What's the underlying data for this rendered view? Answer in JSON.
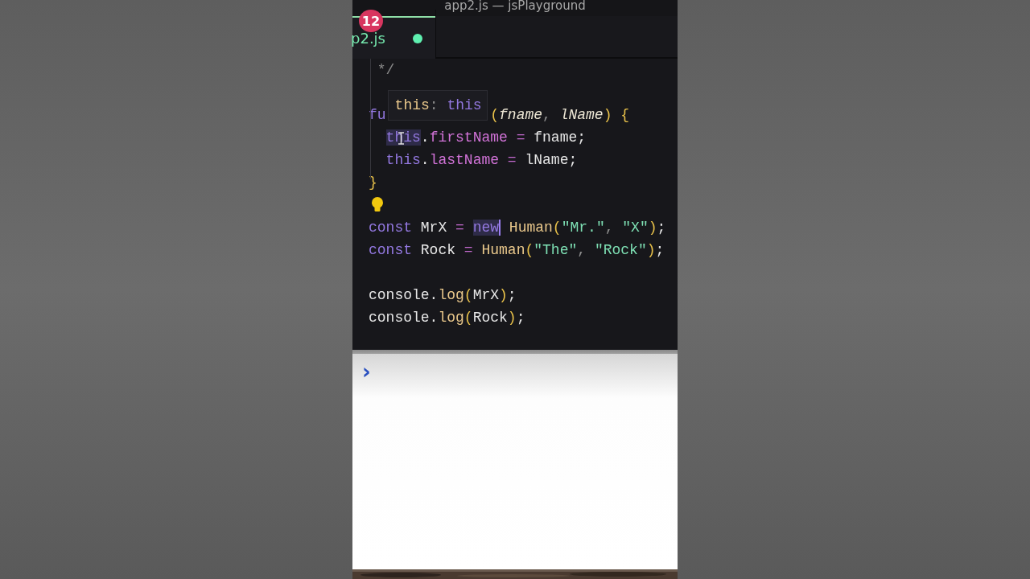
{
  "window": {
    "title": "app2.js — jsPlayground"
  },
  "tabs": [
    {
      "label": "p2.js",
      "selected": true,
      "modified": true,
      "badge": "12"
    }
  ],
  "tooltip": [
    {
      "text": "this",
      "kind": "func"
    },
    {
      "text": ": ",
      "kind": "punct"
    },
    {
      "text": "this",
      "kind": "keyword"
    }
  ],
  "code_lines": [
    {
      "kind": "code",
      "tokens": [
        {
          "text": " */",
          "kind": "comment",
          "highlighted": false,
          "caret": false
        }
      ]
    },
    {
      "kind": "blank"
    },
    {
      "kind": "covered",
      "tokens": [
        {
          "text": "fu",
          "kind": "keyword",
          "highlighted": false,
          "caret": false
        }
      ],
      "rest": [
        {
          "text": "(",
          "kind": "paren",
          "highlighted": false,
          "caret": false
        },
        {
          "text": "fname",
          "kind": "param",
          "highlighted": false,
          "caret": false
        },
        {
          "text": ", ",
          "kind": "punct",
          "highlighted": false,
          "caret": false
        },
        {
          "text": "lName",
          "kind": "param",
          "highlighted": false,
          "caret": false
        },
        {
          "text": ")",
          "kind": "paren",
          "highlighted": false,
          "caret": false
        },
        {
          "text": " {",
          "kind": "paren",
          "highlighted": false,
          "caret": false
        }
      ]
    },
    {
      "kind": "indented",
      "tokens": [
        {
          "text": "this",
          "kind": "keyword",
          "highlighted": true,
          "caret": false
        },
        {
          "text": ".",
          "kind": "plain",
          "highlighted": false,
          "caret": false
        },
        {
          "text": "firstName",
          "kind": "property",
          "highlighted": false,
          "caret": false
        },
        {
          "text": " = ",
          "kind": "operator",
          "highlighted": false,
          "caret": false
        },
        {
          "text": "fname;",
          "kind": "plain",
          "highlighted": false,
          "caret": false
        }
      ]
    },
    {
      "kind": "indented",
      "tokens": [
        {
          "text": "this",
          "kind": "keyword",
          "highlighted": false,
          "caret": false
        },
        {
          "text": ".",
          "kind": "plain",
          "highlighted": false,
          "caret": false
        },
        {
          "text": "lastName",
          "kind": "property",
          "highlighted": false,
          "caret": false
        },
        {
          "text": " = ",
          "kind": "operator",
          "highlighted": false,
          "caret": false
        },
        {
          "text": "lName;",
          "kind": "plain",
          "highlighted": false,
          "caret": false
        }
      ]
    },
    {
      "kind": "code",
      "tokens": [
        {
          "text": "}",
          "kind": "paren",
          "highlighted": false,
          "caret": false
        }
      ]
    },
    {
      "kind": "lightbulb"
    },
    {
      "kind": "code",
      "tokens": [
        {
          "text": "const",
          "kind": "keyword",
          "highlighted": false,
          "caret": false
        },
        {
          "text": " MrX ",
          "kind": "plain",
          "highlighted": false,
          "caret": false
        },
        {
          "text": "= ",
          "kind": "operator",
          "highlighted": false,
          "caret": false
        },
        {
          "text": "new",
          "kind": "keyword",
          "highlighted": true,
          "caret": true
        },
        {
          "text": " Human",
          "kind": "func",
          "highlighted": false,
          "caret": false
        },
        {
          "text": "(",
          "kind": "paren",
          "highlighted": false,
          "caret": false
        },
        {
          "text": "\"Mr.\"",
          "kind": "string",
          "highlighted": false,
          "caret": false
        },
        {
          "text": ", ",
          "kind": "punct",
          "highlighted": false,
          "caret": false
        },
        {
          "text": "\"X\"",
          "kind": "string",
          "highlighted": false,
          "caret": false
        },
        {
          "text": ")",
          "kind": "paren",
          "highlighted": false,
          "caret": false
        },
        {
          "text": ";",
          "kind": "plain",
          "highlighted": false,
          "caret": false
        }
      ]
    },
    {
      "kind": "code",
      "tokens": [
        {
          "text": "const",
          "kind": "keyword",
          "highlighted": false,
          "caret": false
        },
        {
          "text": " Rock ",
          "kind": "plain",
          "highlighted": false,
          "caret": false
        },
        {
          "text": "= ",
          "kind": "operator",
          "highlighted": false,
          "caret": false
        },
        {
          "text": "Human",
          "kind": "func",
          "highlighted": false,
          "caret": false
        },
        {
          "text": "(",
          "kind": "paren",
          "highlighted": false,
          "caret": false
        },
        {
          "text": "\"The\"",
          "kind": "string",
          "highlighted": false,
          "caret": false
        },
        {
          "text": ", ",
          "kind": "punct",
          "highlighted": false,
          "caret": false
        },
        {
          "text": "\"Rock\"",
          "kind": "string",
          "highlighted": false,
          "caret": false
        },
        {
          "text": ")",
          "kind": "paren",
          "highlighted": false,
          "caret": false
        },
        {
          "text": ";",
          "kind": "plain",
          "highlighted": false,
          "caret": false
        }
      ]
    },
    {
      "kind": "blank"
    },
    {
      "kind": "code",
      "tokens": [
        {
          "text": "console.",
          "kind": "plain",
          "highlighted": false,
          "caret": false
        },
        {
          "text": "log",
          "kind": "func",
          "highlighted": false,
          "caret": false
        },
        {
          "text": "(",
          "kind": "paren",
          "highlighted": false,
          "caret": false
        },
        {
          "text": "MrX",
          "kind": "plain",
          "highlighted": false,
          "caret": false
        },
        {
          "text": ")",
          "kind": "paren",
          "highlighted": false,
          "caret": false
        },
        {
          "text": ";",
          "kind": "plain",
          "highlighted": false,
          "caret": false
        }
      ]
    },
    {
      "kind": "code",
      "tokens": [
        {
          "text": "console.",
          "kind": "plain",
          "highlighted": false,
          "caret": false
        },
        {
          "text": "log",
          "kind": "func",
          "highlighted": false,
          "caret": false
        },
        {
          "text": "(",
          "kind": "paren",
          "highlighted": false,
          "caret": false
        },
        {
          "text": "Rock",
          "kind": "plain",
          "highlighted": false,
          "caret": false
        },
        {
          "text": ")",
          "kind": "paren",
          "highlighted": false,
          "caret": false
        },
        {
          "text": ";",
          "kind": "plain",
          "highlighted": false,
          "caret": false
        }
      ]
    }
  ],
  "console": {
    "prompt": "›"
  }
}
